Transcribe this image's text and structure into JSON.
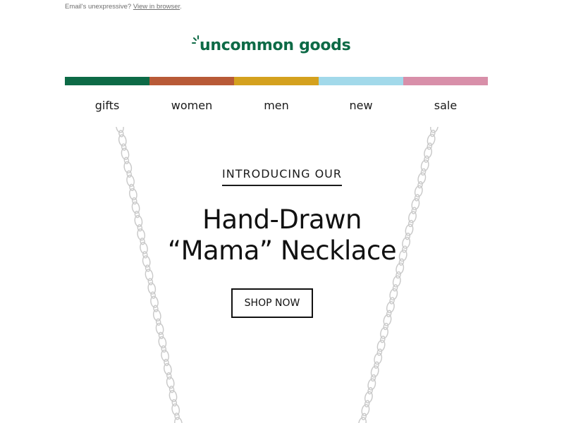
{
  "preheader": {
    "text": "Email's unexpressive? ",
    "link_label": "View in browser",
    "suffix": "."
  },
  "logo": {
    "text": "uncommon goods",
    "color": "#0d6a46",
    "icon": "sunburst-icon"
  },
  "colorbar": [
    "#0d6a46",
    "#b85a37",
    "#d4a11e",
    "#a2d9ea",
    "#d88fa9"
  ],
  "nav": [
    "gifts",
    "women",
    "men",
    "new",
    "sale"
  ],
  "hero": {
    "eyebrow": "INTRODUCING OUR",
    "headline_line1": "Hand-Drawn",
    "headline_line2": "“Mama” Necklace",
    "cta_label": "SHOP NOW",
    "image": "silver-chain-necklace"
  }
}
